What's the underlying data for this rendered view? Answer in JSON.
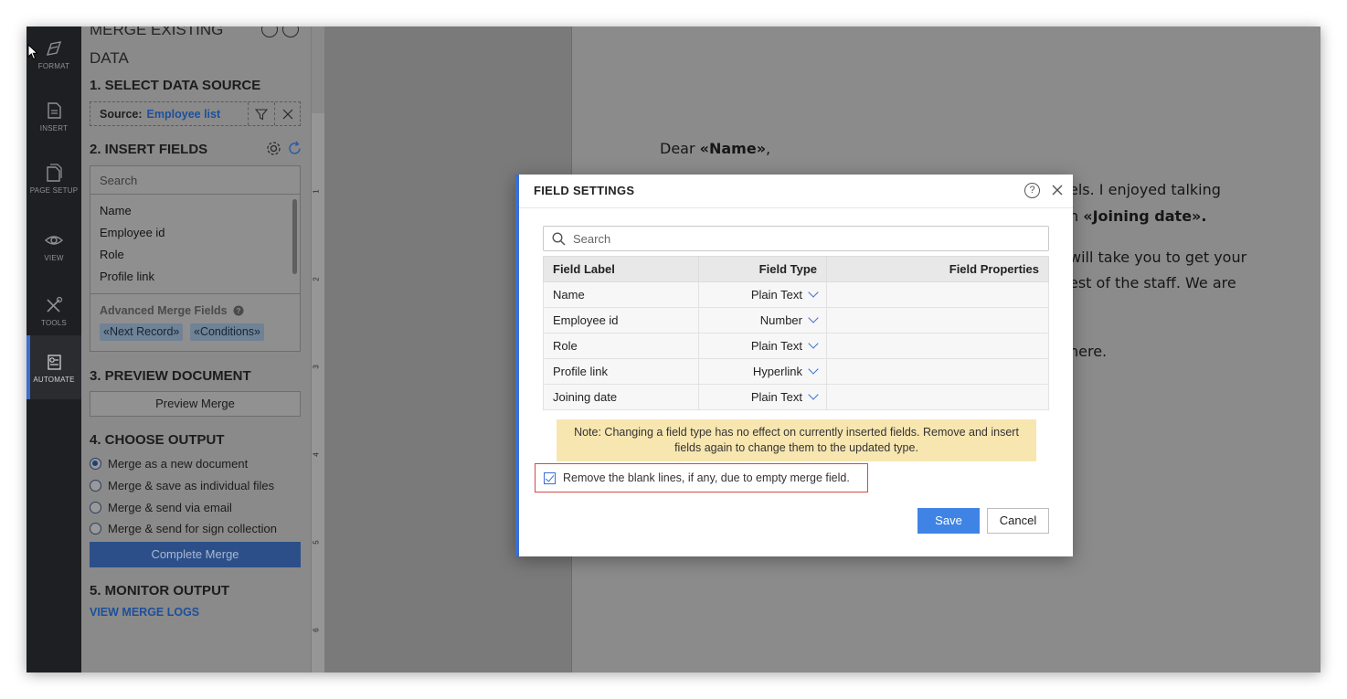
{
  "rail": {
    "items": [
      {
        "label": "FORMAT"
      },
      {
        "label": "INSERT"
      },
      {
        "label": "PAGE SETUP"
      },
      {
        "label": "VIEW"
      },
      {
        "label": "TOOLS"
      },
      {
        "label": "AUTOMATE"
      }
    ],
    "active": "AUTOMATE"
  },
  "panel": {
    "title": "MERGE EXISTING DATA",
    "step1": "1. SELECT DATA SOURCE",
    "source_label": "Source:",
    "source_value": "Employee list",
    "step2": "2. INSERT FIELDS",
    "search_placeholder": "Search",
    "fields": [
      "Name",
      "Employee id",
      "Role",
      "Profile link"
    ],
    "advanced_title": "Advanced Merge Fields",
    "advanced_chips": [
      "«Next Record»",
      "«Conditions»"
    ],
    "step3": "3. PREVIEW DOCUMENT",
    "preview_button": "Preview Merge",
    "step4": "4. CHOOSE OUTPUT",
    "outputs": [
      {
        "label": "Merge as a new document",
        "selected": true
      },
      {
        "label": "Merge & save as individual files",
        "selected": false
      },
      {
        "label": "Merge & send via email",
        "selected": false
      },
      {
        "label": "Merge & send for sign collection",
        "selected": false
      }
    ],
    "complete_button": "Complete Merge",
    "step5": "5. MONITOR OUTPUT",
    "logs_link": "VIEW MERGE LOGS"
  },
  "ruler": {
    "marks": [
      "1",
      "2",
      "3",
      "4",
      "5",
      "6"
    ]
  },
  "document": {
    "greeting": "Dear ",
    "greeting_field": "«Name»",
    "greeting_end": ",",
    "line1": "els. I enjoyed talking",
    "line2_prefix": "n ",
    "line2_field": "«Joining date».",
    "line3": "will take you to get your",
    "line4": "est of the staff. We are",
    "line5": "here."
  },
  "modal": {
    "title": "FIELD SETTINGS",
    "help": "?",
    "search_placeholder": "Search",
    "columns": [
      "Field Label",
      "Field Type",
      "Field Properties"
    ],
    "rows": [
      {
        "label": "Name",
        "type": "Plain Text",
        "properties": ""
      },
      {
        "label": "Employee id",
        "type": "Number",
        "properties": ""
      },
      {
        "label": "Role",
        "type": "Plain Text",
        "properties": ""
      },
      {
        "label": "Profile link",
        "type": "Hyperlink",
        "properties": ""
      },
      {
        "label": "Joining date",
        "type": "Plain Text",
        "properties": ""
      }
    ],
    "note": "Note: Changing a field type has no effect on currently inserted fields. Remove and insert fields again to change them to the updated type.",
    "remove_blank_label": "Remove the blank lines, if any, due to empty merge field.",
    "remove_blank_checked": true,
    "save": "Save",
    "cancel": "Cancel"
  },
  "colors": {
    "accent": "#3b6ed4",
    "save": "#3f84e5",
    "note_bg": "#f8e6b0",
    "highlight_border": "#d24a48"
  }
}
